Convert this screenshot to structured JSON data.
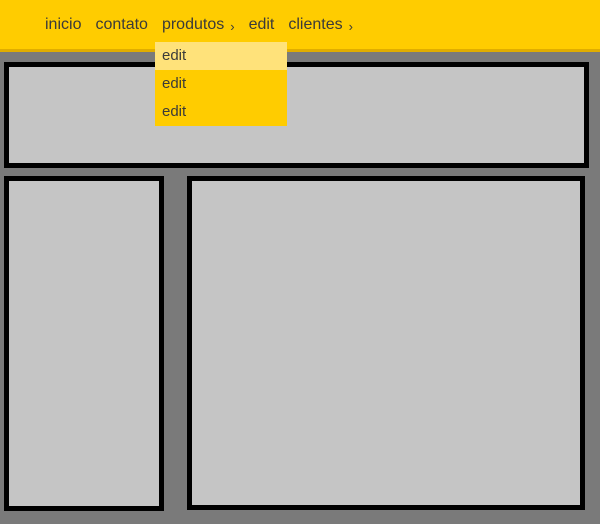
{
  "nav": {
    "items": [
      {
        "label": "inicio"
      },
      {
        "label": "contato"
      },
      {
        "label": "produtos",
        "arrow": "›"
      },
      {
        "label": "edit"
      },
      {
        "label": "clientes",
        "arrow": "›"
      }
    ]
  },
  "dropdown": {
    "items": [
      {
        "label": "edit"
      },
      {
        "label": "edit"
      },
      {
        "label": "edit"
      }
    ]
  },
  "colors": {
    "accent": "#ffcc00",
    "hover": "#ffe27a",
    "panel": "#c5c5c5",
    "background": "#7a7a7a"
  }
}
